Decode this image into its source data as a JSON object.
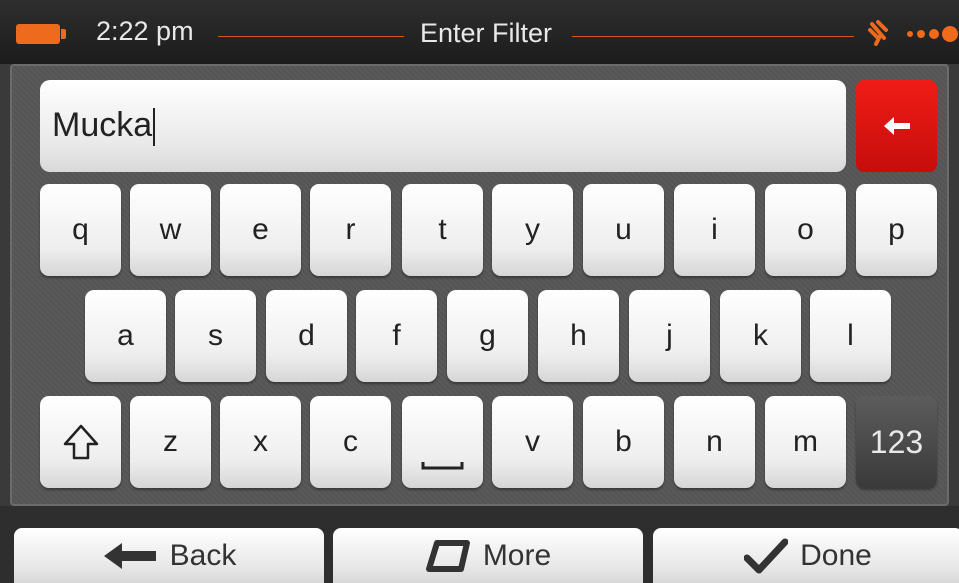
{
  "status_bar": {
    "time": "2:22 pm",
    "title": "Enter Filter",
    "battery_color": "#ee6a1c",
    "accent_color": "#d2571a"
  },
  "input": {
    "value": "Mucka"
  },
  "keyboard": {
    "row1": [
      "q",
      "w",
      "e",
      "r",
      "t",
      "y",
      "u",
      "i",
      "o",
      "p"
    ],
    "row2": [
      "a",
      "s",
      "d",
      "f",
      "g",
      "h",
      "j",
      "k",
      "l"
    ],
    "row3": [
      "z",
      "x",
      "c",
      "v",
      "b",
      "n",
      "m"
    ],
    "numeric_label": "123",
    "icons": {
      "backspace": "arrow-left-icon",
      "shift": "shift-arrow-icon",
      "space": "space-bar-icon"
    }
  },
  "bottom_bar": {
    "back_label": "Back",
    "more_label": "More",
    "done_label": "Done"
  }
}
